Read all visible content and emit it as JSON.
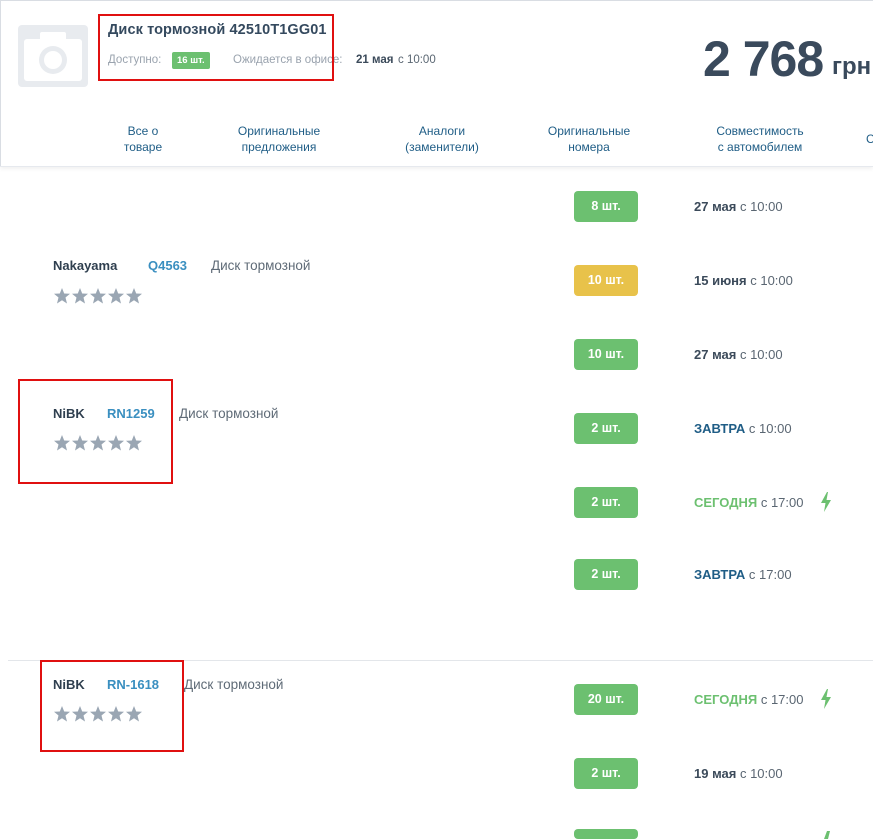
{
  "product": {
    "title": "Диск тормозной 42510T1GG01",
    "available_label": "Доступно:",
    "available_badge": "16 шт.",
    "expected_label": "Ожидается в офисе:",
    "expected_date": "21 мая",
    "expected_time": "с 10:00",
    "price": "2 768",
    "currency": "грн"
  },
  "nav": {
    "tabs": [
      {
        "label": "Все о\nтоваре"
      },
      {
        "label": "Оригинальные\nпредложения"
      },
      {
        "label": "Аналоги\n(заменители)"
      },
      {
        "label": "Оригинальные\nномера"
      },
      {
        "label": "Совместимость\nс автомобилем"
      },
      {
        "label": "С"
      }
    ]
  },
  "offers": [
    {
      "brand": "Nakayama",
      "article": "Q4563",
      "description": "Диск тормозной",
      "rating": 0
    },
    {
      "brand": "NiBK",
      "article": "RN1259",
      "description": "Диск тормозной",
      "rating": 0
    },
    {
      "brand": "NiBK",
      "article": "RN-1618",
      "description": "Диск тормозной",
      "rating": 0
    }
  ],
  "stock": [
    {
      "qty": "8 шт.",
      "color": "green",
      "date": "27 мая",
      "date_style": "dark",
      "time": "с 10:00",
      "express": false
    },
    {
      "qty": "10 шт.",
      "color": "yellow",
      "date": "15 июня",
      "date_style": "dark",
      "time": "с 10:00",
      "express": false
    },
    {
      "qty": "10 шт.",
      "color": "green",
      "date": "27 мая",
      "date_style": "dark",
      "time": "с 10:00",
      "express": false
    },
    {
      "qty": "2 шт.",
      "color": "green",
      "date": "ЗАВТРА",
      "date_style": "blue",
      "time": "с 10:00",
      "express": false
    },
    {
      "qty": "2 шт.",
      "color": "green",
      "date": "СЕГОДНЯ",
      "date_style": "green",
      "time": "с 17:00",
      "express": true
    },
    {
      "qty": "2 шт.",
      "color": "green",
      "date": "ЗАВТРА",
      "date_style": "blue",
      "time": "с 17:00",
      "express": false
    },
    {
      "qty": "20 шт.",
      "color": "green",
      "date": "СЕГОДНЯ",
      "date_style": "green",
      "time": "с 17:00",
      "express": true
    },
    {
      "qty": "2 шт.",
      "color": "green",
      "date": "19 мая",
      "date_style": "dark",
      "time": "с 10:00",
      "express": false
    }
  ],
  "colors": {
    "accent_green": "#6cc070",
    "accent_yellow": "#e8c24a",
    "link_blue": "#3a8fc0",
    "nav_blue": "#1f5d86",
    "highlight_red": "#e01010"
  }
}
